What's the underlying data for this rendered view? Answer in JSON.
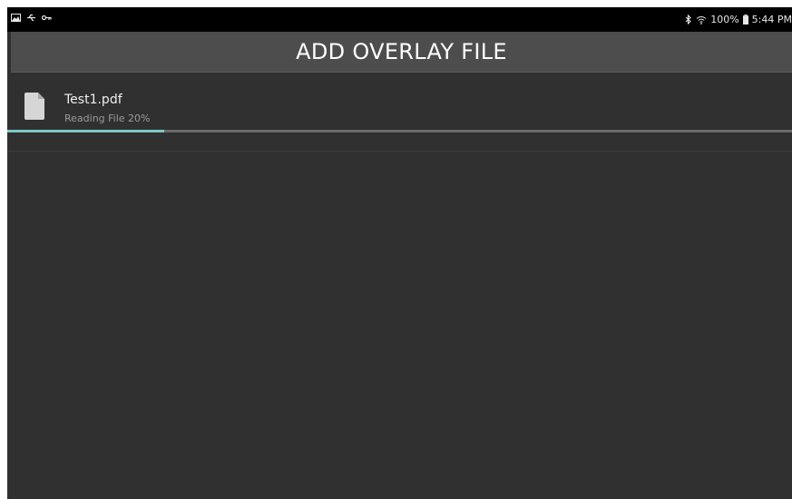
{
  "status_bar": {
    "left_icons": [
      "image-icon",
      "usb-icon",
      "key-icon"
    ],
    "battery": "100%",
    "time": "5:44 PM",
    "right_icons": [
      "bluetooth-icon",
      "wifi-icon",
      "battery-icon"
    ]
  },
  "header": {
    "title": "ADD OVERLAY FILE"
  },
  "files": [
    {
      "name": "Test1.pdf",
      "status": "Reading File 20%",
      "progress": 0.2,
      "icon": "document-icon"
    }
  ],
  "colors": {
    "background": "#303030",
    "header": "#4d4d4d",
    "progress_fill": "#7fc7c7",
    "progress_track": "#6a6a6a"
  }
}
